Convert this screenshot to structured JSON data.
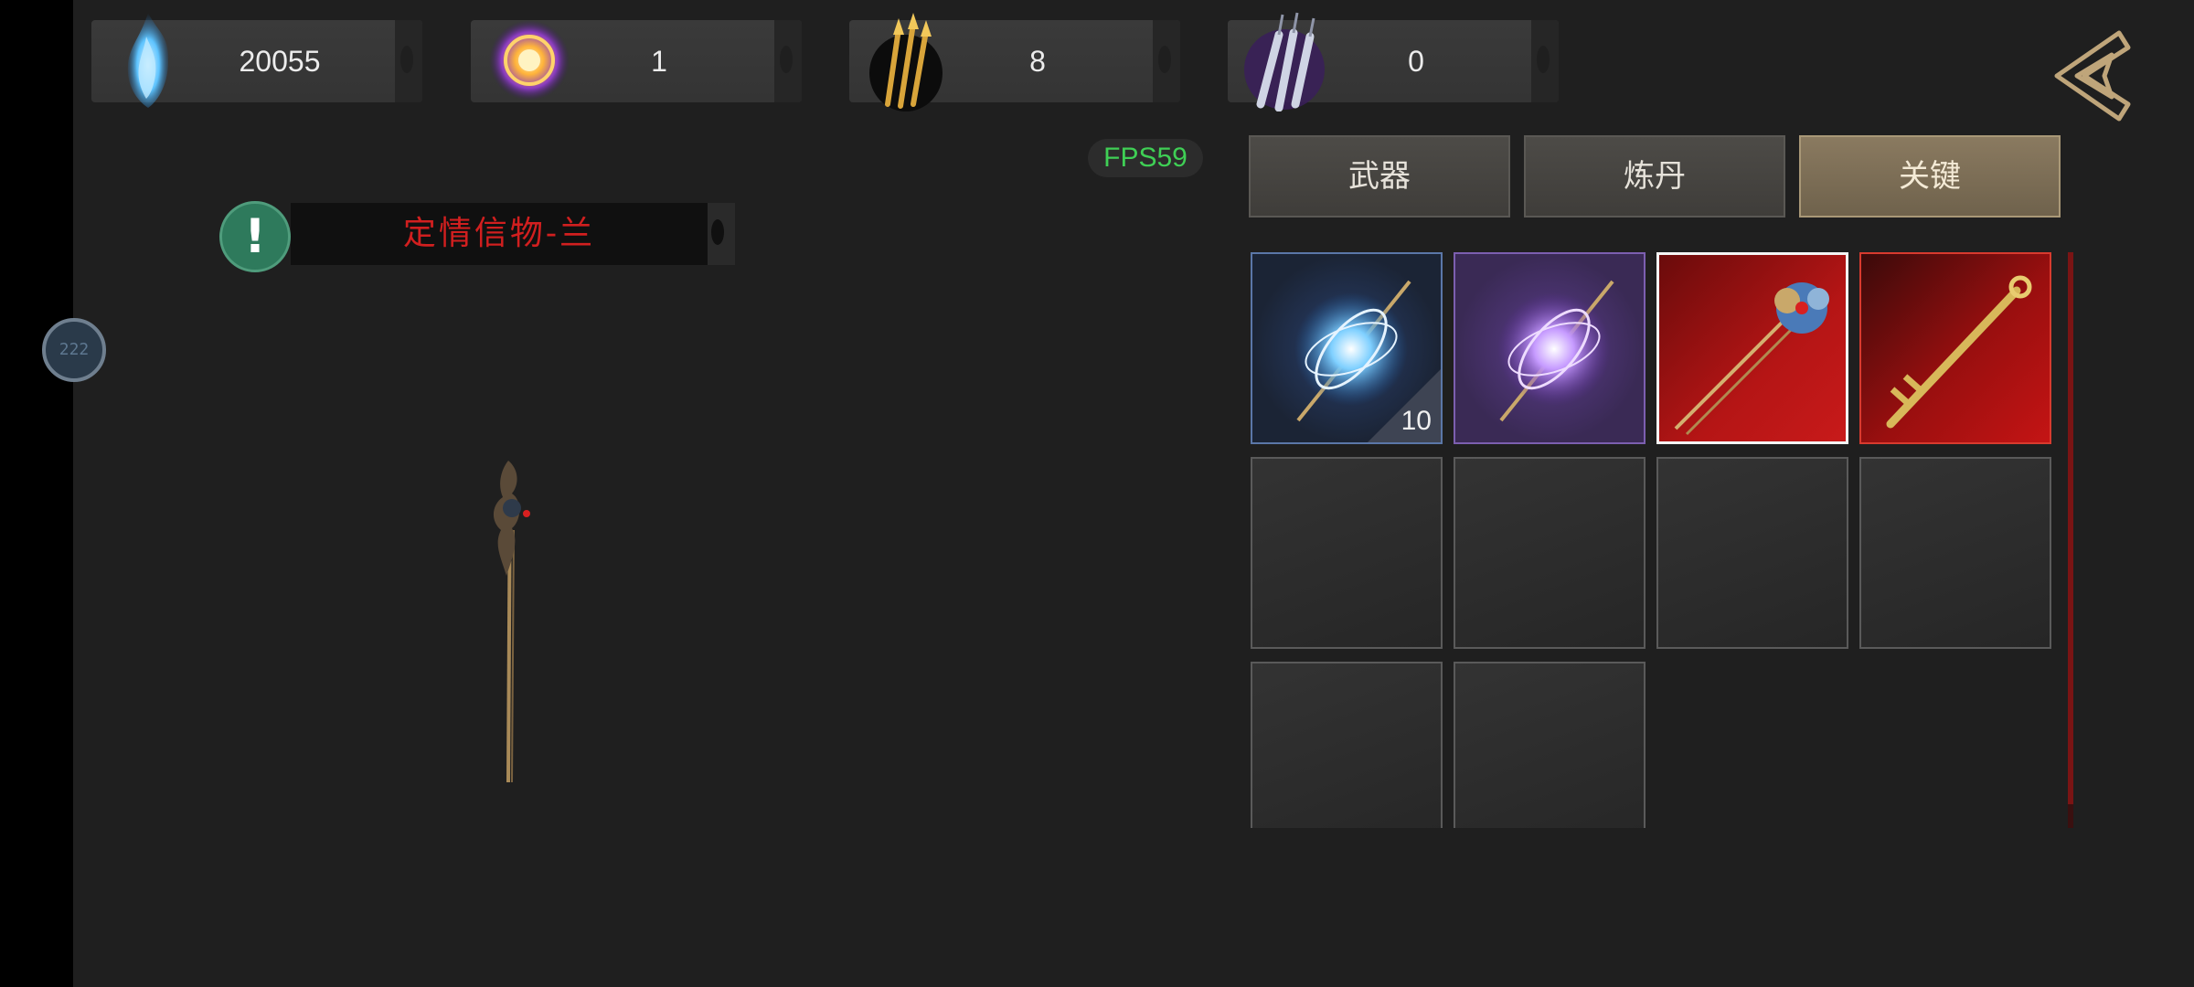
{
  "currencies": [
    {
      "name": "blue-flame-icon",
      "value": "20055"
    },
    {
      "name": "golden-orb-icon",
      "value": "1"
    },
    {
      "name": "golden-arrows-icon",
      "value": "8"
    },
    {
      "name": "purple-blades-icon",
      "value": "0"
    }
  ],
  "fps": "FPS59",
  "tabs": [
    {
      "label": "武器",
      "active": false
    },
    {
      "label": "炼丹",
      "active": false
    },
    {
      "label": "关键",
      "active": true
    }
  ],
  "notice": {
    "text": "定情信物-兰"
  },
  "avatar": {
    "text": "222"
  },
  "inventory": {
    "items": [
      {
        "icon": "blue-orb-needle-icon",
        "rarity": "blue",
        "count": "10"
      },
      {
        "icon": "purple-orb-needle-icon",
        "rarity": "purple",
        "count": ""
      },
      {
        "icon": "flower-hairpin-icon",
        "rarity": "red",
        "selected": true,
        "count": ""
      },
      {
        "icon": "golden-key-icon",
        "rarity": "red",
        "count": ""
      }
    ],
    "empty_slots": 6
  },
  "colors": {
    "background": "#1f1f1f",
    "fps_green": "#3fcf55",
    "notice_red": "#d11f1f",
    "active_tab": "#7d6e56"
  }
}
